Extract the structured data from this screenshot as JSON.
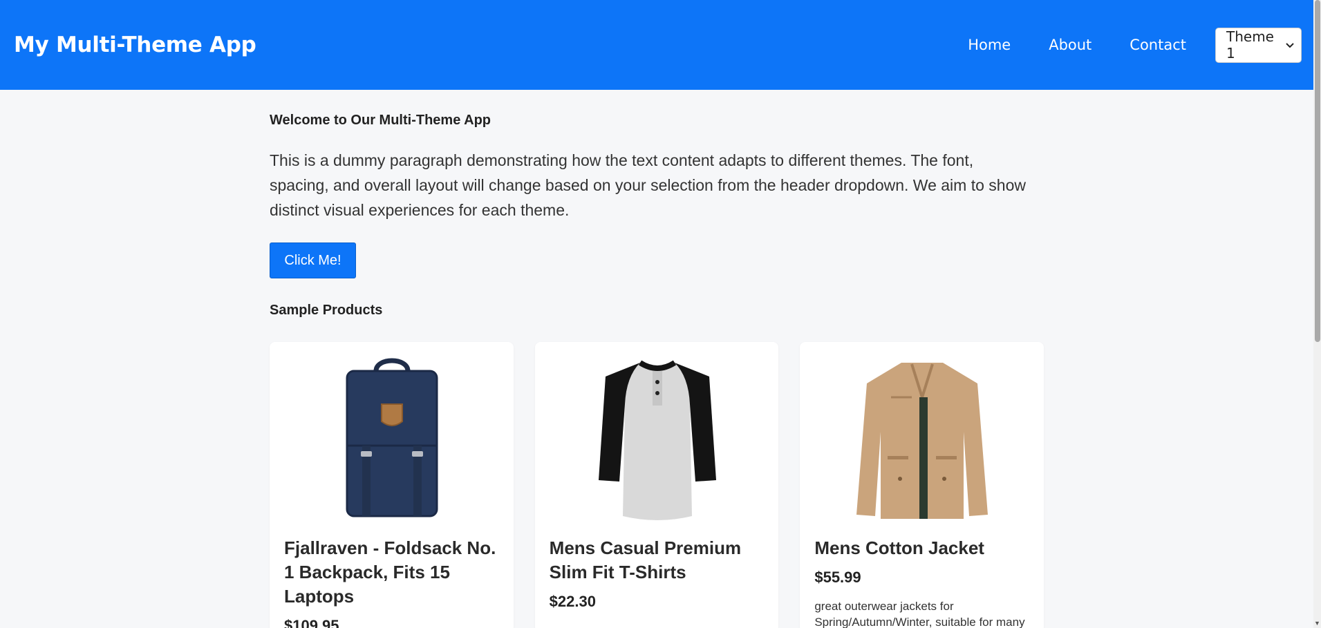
{
  "header": {
    "brand": "My Multi-Theme App",
    "nav": [
      "Home",
      "About",
      "Contact"
    ],
    "theme_select": "Theme 1"
  },
  "main": {
    "welcome": "Welcome to Our Multi-Theme App",
    "intro": "This is a dummy paragraph demonstrating how the text content adapts to different themes. The font, spacing, and overall layout will change based on your selection from the header dropdown. We aim to show distinct visual experiences for each theme.",
    "cta": "Click Me!",
    "products_title": "Sample Products",
    "products": [
      {
        "title": "Fjallraven - Foldsack No. 1 Backpack, Fits 15 Laptops",
        "price": "$109.95",
        "description": "",
        "image": "backpack-image"
      },
      {
        "title": "Mens Casual Premium Slim Fit T-Shirts",
        "price": "$22.30",
        "description": "",
        "image": "tshirt-image"
      },
      {
        "title": "Mens Cotton Jacket",
        "price": "$55.99",
        "description": "great outerwear jackets for Spring/Autumn/Winter, suitable for many",
        "image": "jacket-image"
      }
    ]
  },
  "colors": {
    "accent": "#0d75f8",
    "background": "#f6f7f9",
    "card": "#ffffff"
  }
}
